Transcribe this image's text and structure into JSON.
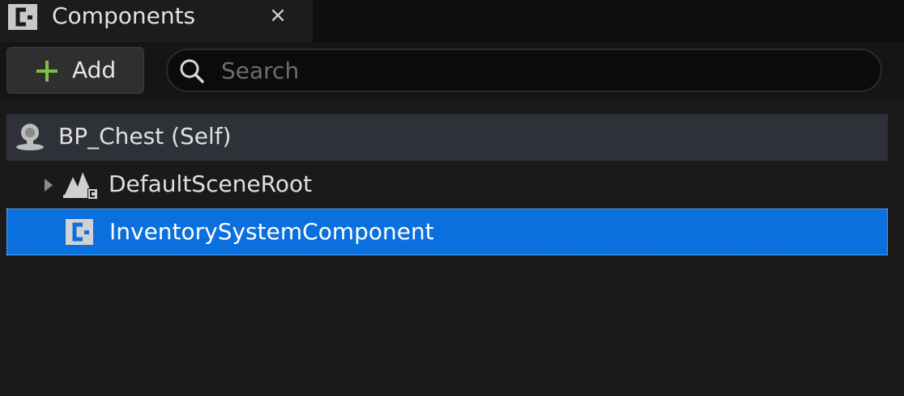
{
  "tab": {
    "title": "Components",
    "close_glyph": "×",
    "icon": "component-c-icon"
  },
  "toolbar": {
    "add_label": "Add",
    "add_icon": "plus-icon",
    "search": {
      "placeholder": "Search",
      "value": "",
      "icon": "search-icon"
    }
  },
  "tree": {
    "items": [
      {
        "label": "BP_Chest (Self)",
        "icon": "actor-icon",
        "selected": false,
        "hovered": true
      },
      {
        "label": "DefaultSceneRoot",
        "icon": "scene-component-icon",
        "expandable": true,
        "expanded": false
      },
      {
        "label": "InventorySystemComponent",
        "icon": "component-c-icon",
        "selected": true
      }
    ]
  },
  "colors": {
    "background": "#1a1a1a",
    "tab_strip": "#0f0f0f",
    "selection": "#0a70de",
    "hover_row": "#2e3138",
    "add_plus": "#7bc043"
  }
}
